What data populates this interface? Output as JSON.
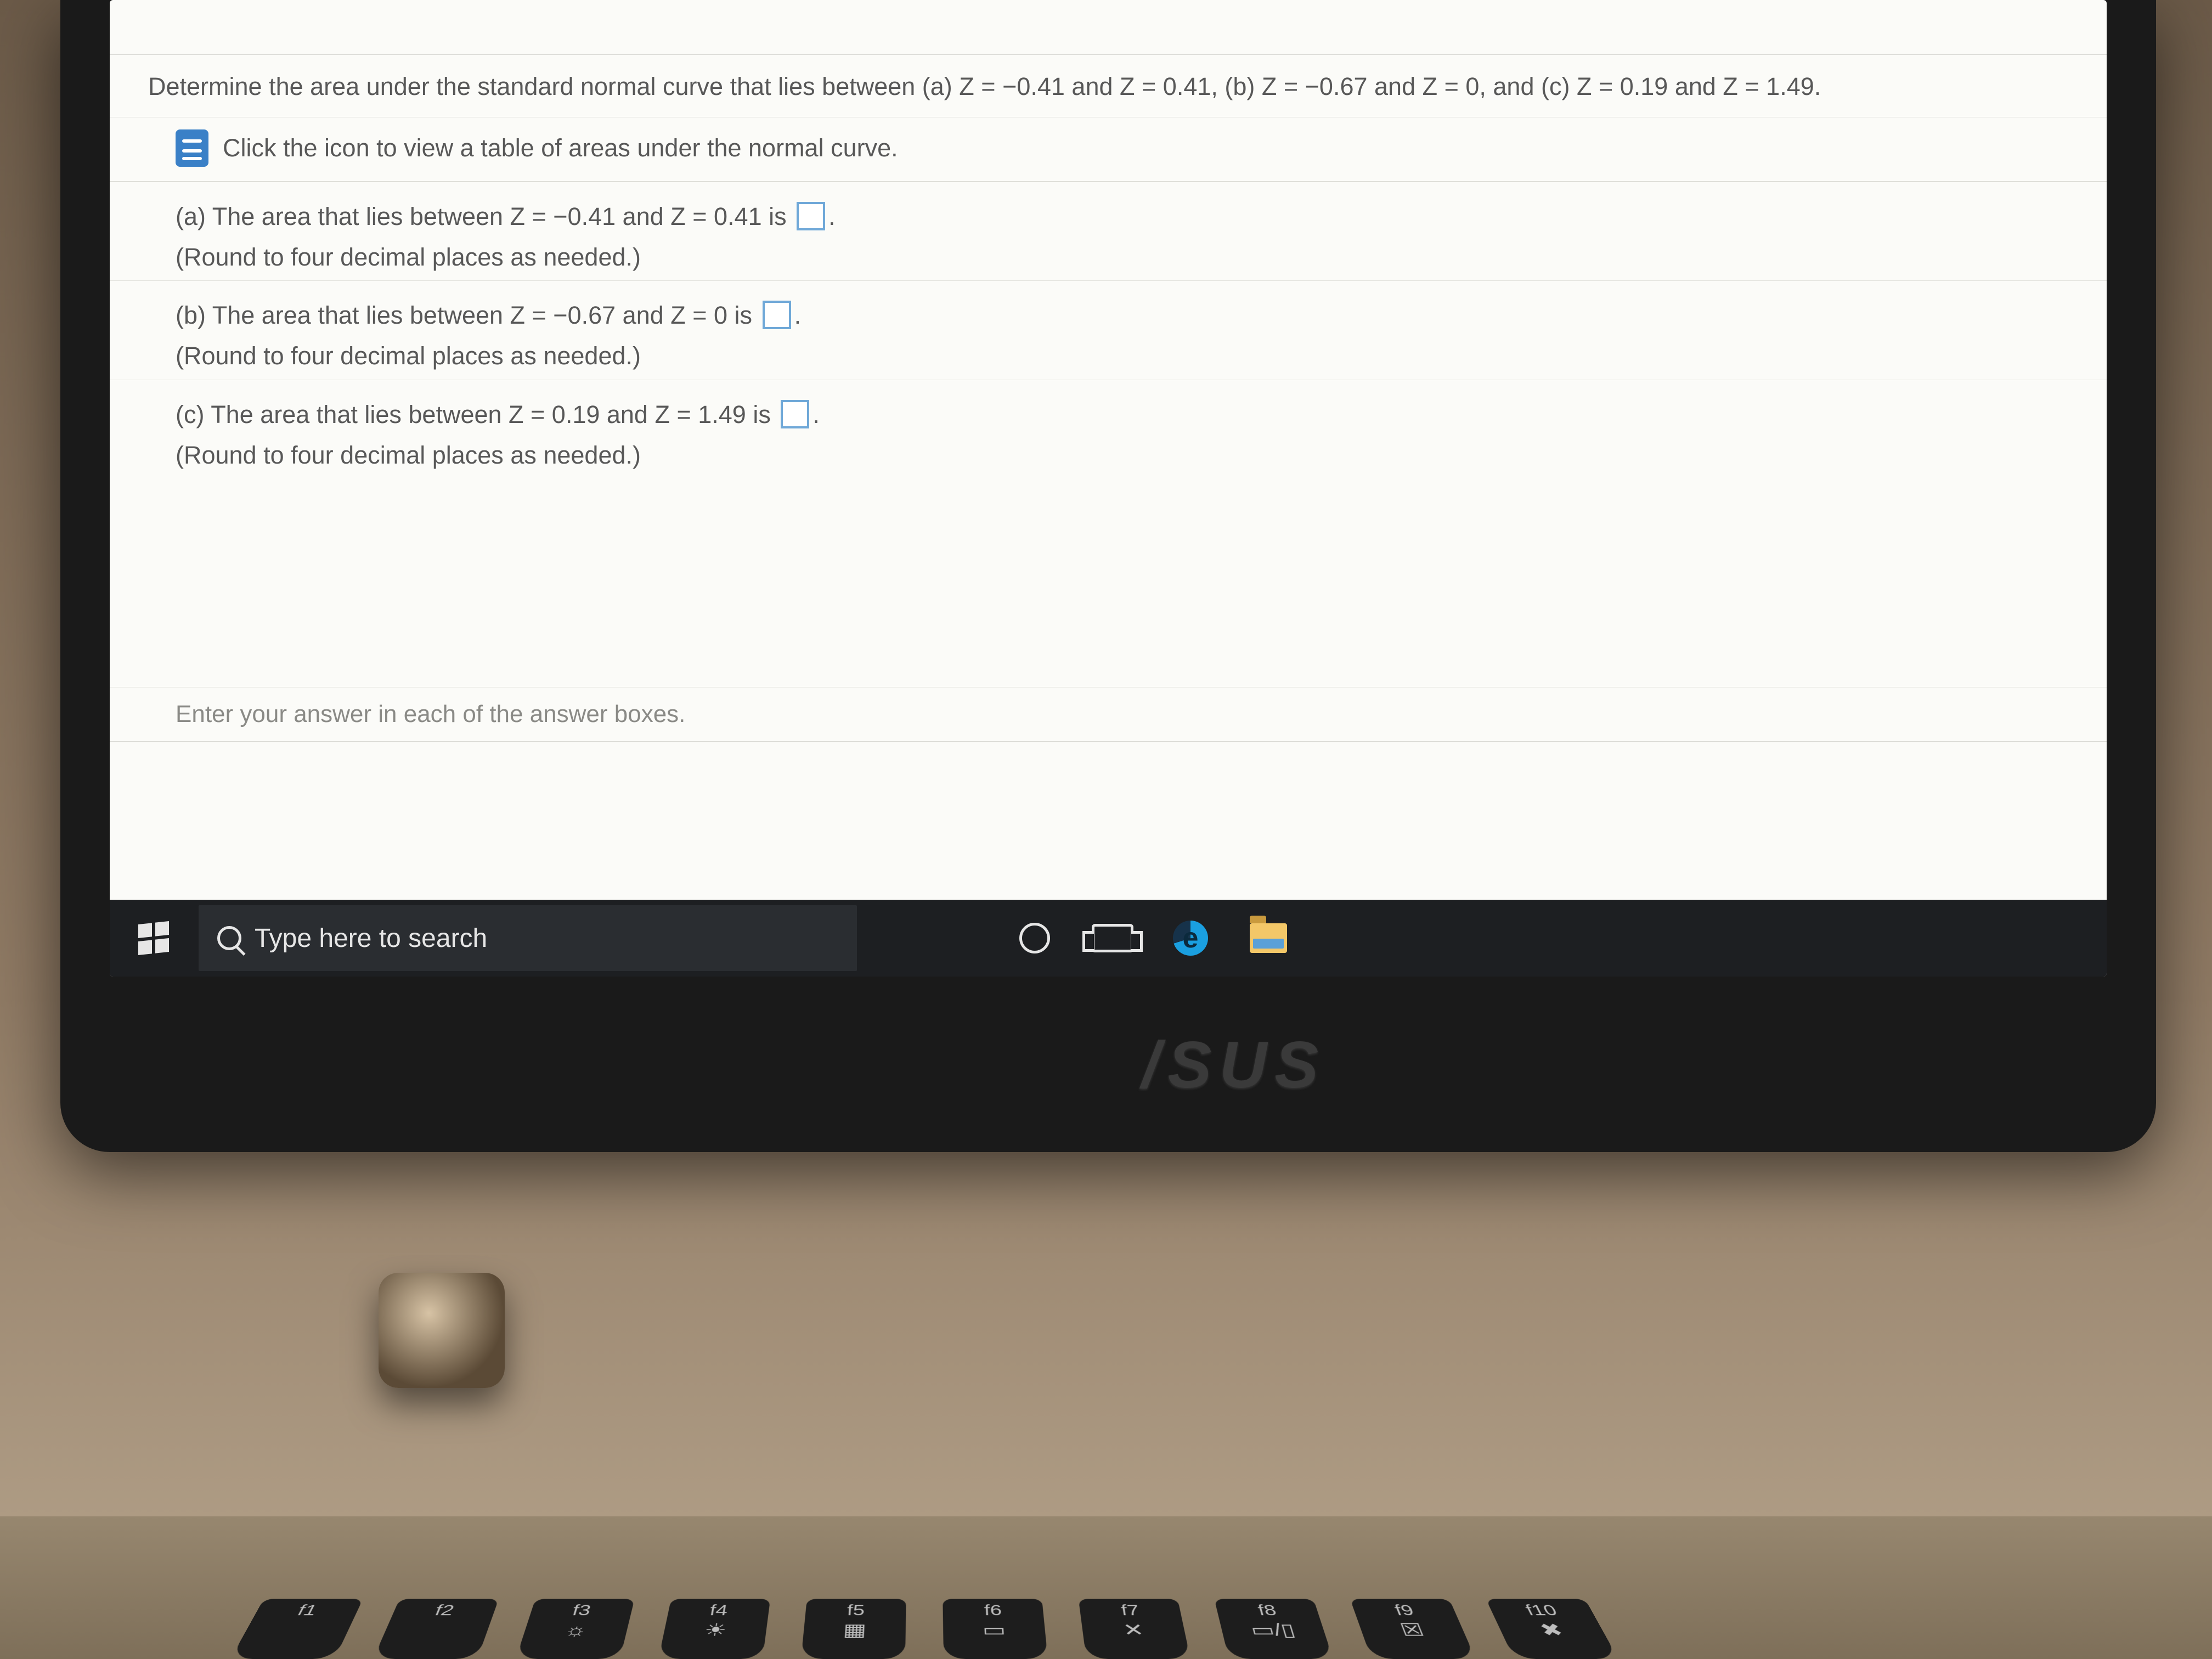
{
  "question": {
    "prompt": "Determine the area under the standard normal curve that lies between (a) Z = −0.41 and Z = 0.41, (b) Z = −0.67 and Z = 0, and (c) Z = 0.19 and Z = 1.49.",
    "table_link": "Click the icon to view a table of areas under the normal curve.",
    "parts": [
      {
        "label": "(a)",
        "text": "The area that lies between Z = −0.41 and Z = 0.41 is",
        "round": "(Round to four decimal places as needed.)"
      },
      {
        "label": "(b)",
        "text": "The area that lies between Z = −0.67 and Z = 0 is",
        "round": "(Round to four decimal places as needed.)"
      },
      {
        "label": "(c)",
        "text": "The area that lies between Z = 0.19 and Z = 1.49 is",
        "round": "(Round to four decimal places as needed.)"
      }
    ],
    "footer": "Enter your answer in each of the answer boxes."
  },
  "taskbar": {
    "search_placeholder": "Type here to search"
  },
  "laptop_brand": "/SUS",
  "fn_keys": [
    "f1",
    "f2",
    "f3",
    "f4",
    "f5",
    "f6",
    "f7",
    "f8",
    "f9",
    "f10"
  ],
  "fn_glyphs": [
    "",
    "",
    "☼",
    "☀",
    "▦",
    "▭",
    "✕",
    "▭/▯",
    "☒",
    "✖"
  ]
}
